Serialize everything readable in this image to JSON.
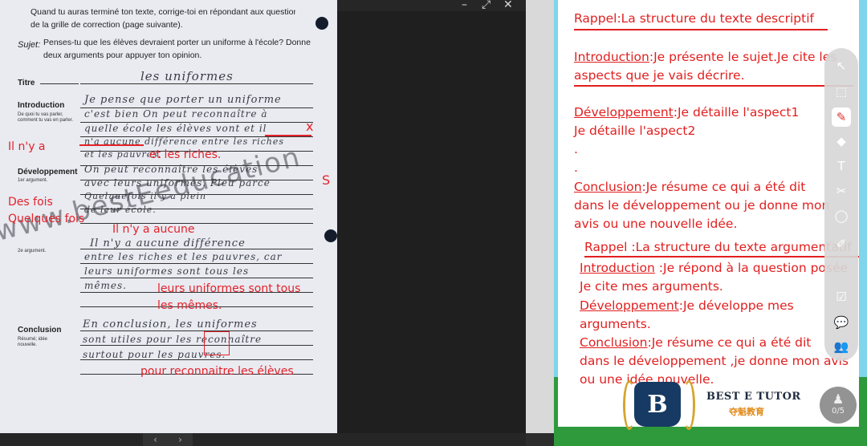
{
  "window": {
    "minimize": "–",
    "maximize": "⤢",
    "close": "✕"
  },
  "pager": {
    "prev": "‹",
    "next": "›"
  },
  "worksheet": {
    "instruction_line1": "Quand tu auras terminé ton texte, corrige-toi en répondant aux questions",
    "instruction_line2": "de la grille de correction (page suivante).",
    "sujet_label": "Sujet:",
    "sujet_line1": "Penses-tu que les élèves devraient porter un uniforme à l'école? Donne",
    "sujet_line2": "deux arguments pour appuyer ton opinion.",
    "labels": {
      "titre": "Titre",
      "introduction": "Introduction",
      "intro_hint": "De quoi tu vas parler, comment tu vas en parler.",
      "developpement": "Développement",
      "arg1": "1er argument.",
      "arg2": "2e argument.",
      "conclusion": "Conclusion",
      "conclusion_hint": "Résumé; idée nouvelle."
    },
    "handwriting": {
      "titre": "les uniformes",
      "intro1": "Je pense que porter un uniforme",
      "intro2": "c'est bien On peut reconnaître à",
      "intro3": "quelle école les élèves vont et il",
      "intro4": "n'a aucune différence entre les riches",
      "intro5": "et les pauvres.",
      "dev1": "On peut reconnaître les élèves",
      "dev2": "avec leurs uniformes. Pleu parce",
      "dev3": "Quelquefois il y a plein",
      "dev4": "de leur école.",
      "dev5": "Il n'y a aucune différence",
      "dev6": "entre les riches et les pauvres, car",
      "dev7": "leurs uniformes sont tous les",
      "dev8": "mêmes.",
      "concl1": "En conclusion, les uniformes",
      "concl2": "sont utiles pour les reconnaître",
      "concl3": "surtout pour les pauvres."
    },
    "corrections": {
      "c1": "Il n'y a",
      "c2": "et les riches.",
      "c3": "Des fois",
      "c4": "Quelques fois",
      "c5": "Il n'y a aucune",
      "c6": "leurs uniformes sont tous",
      "c7": "les mêmes.",
      "c8": "pour reconnaitre les élèves",
      "mark_x": "x",
      "mark_s": "S"
    },
    "watermark": "www.bestEeducation"
  },
  "notes": {
    "rappel1": "Rappel:La structure du texte descriptif",
    "intro_kw": "Introduction",
    "intro_l1": ":Je présente le sujet.Je cite les",
    "intro_l2": "aspects que je vais décrire.",
    "dev_kw": "Développement",
    "dev_l1": ":Je détaille l'aspect1",
    "dev_l2": "Je détaille l'aspect2",
    "dot": ".",
    "concl_kw": "Conclusion",
    "concl_l1": ":Je résume ce qui a été dit",
    "concl_l2": "dans le développement ou je donne mon",
    "concl_l3": "avis ou une nouvelle idée.",
    "rappel2": "Rappel :La structure du texte argumentatif",
    "intro2_kw": "Introduction",
    "intro2_l1": " :Je répond à la question posée",
    "intro2_l2": "Je cite mes arguments.",
    "dev2_kw": "Développement",
    "dev2_l1": ":Je développe mes",
    "dev2_l2": "arguments.",
    "concl2_kw": "Conclusion",
    "concl2_l1": ":Je résume ce qui a été dit",
    "concl2_l2": "dans le développement ,je donne mon avis",
    "concl2_l3": "ou une idée nouvelle."
  },
  "toolbar": {
    "tools": [
      "cursor-icon",
      "selection-icon",
      "highlighter-icon",
      "eraser-icon",
      "text-icon",
      "scissors-icon",
      "shape-icon",
      "pen-icon",
      "edit-icon",
      "comment-icon",
      "users-icon"
    ],
    "glyphs": {
      "cursor": "↖",
      "select": "⬚",
      "pen": "✎",
      "erase": "◆",
      "text": "T",
      "cut": "✂",
      "shape": "◯",
      "draw": "✐",
      "edit": "☑",
      "comment": "💬",
      "users": "👥"
    },
    "page_count": "0/5"
  },
  "brand": {
    "logo_letter": "B",
    "name": "BEST E TUTOR",
    "name_cn": "夺魁教育"
  },
  "colors": {
    "annotation_red": "#e21f1f",
    "logo_navy": "#163a63",
    "brand_gold": "#d6a52e"
  }
}
